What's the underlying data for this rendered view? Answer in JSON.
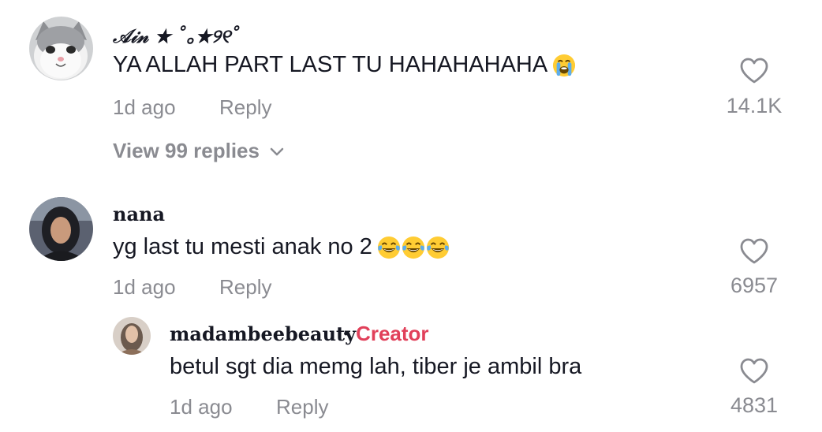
{
  "comments": [
    {
      "username": "𝒜𝒾𝓃 ★ ˚｡★୨୧˚",
      "text": "YA ALLAH PART LAST TU HAHAHAHAHA",
      "emoji": "loudly-crying-face",
      "time": "1d ago",
      "reply_label": "Reply",
      "likes": "14.1K",
      "view_replies": "View 99 replies"
    },
    {
      "username": "nana",
      "text": "yg last tu mesti anak no 2",
      "emoji": "tears-of-joy-face",
      "time": "1d ago",
      "reply_label": "Reply",
      "likes": "6957"
    }
  ],
  "reply": {
    "username": "madambeebeauty",
    "separator": "·",
    "badge": "Creator",
    "text": "betul sgt dia memg lah, tiber je ambil bra",
    "time": "1d ago",
    "reply_label": "Reply",
    "likes": "4831"
  },
  "colors": {
    "primary_text": "#161823",
    "secondary_text": "#8a8b91",
    "creator_badge": "#e1405a"
  }
}
